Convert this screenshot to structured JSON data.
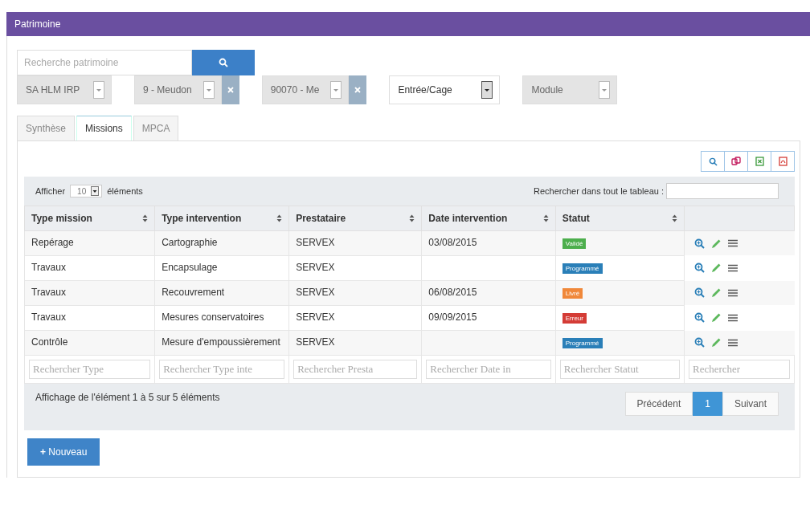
{
  "window": {
    "title": "Patrimoine"
  },
  "search": {
    "placeholder": "Recherche patrimoine"
  },
  "filters": [
    {
      "value": "SA HLM IRP",
      "disabled": true,
      "clearable": false
    },
    {
      "value": "9 - Meudon",
      "disabled": true,
      "clearable": true
    },
    {
      "value": "90070 - Me",
      "disabled": true,
      "clearable": true
    },
    {
      "value": "Entrée/Cage",
      "disabled": false,
      "clearable": false
    },
    {
      "value": "Module",
      "disabled": true,
      "clearable": false
    }
  ],
  "tabs": [
    {
      "label": "Synthèse",
      "selected": false
    },
    {
      "label": "Missions",
      "selected": true
    },
    {
      "label": "MPCA",
      "selected": false
    }
  ],
  "toolbar": [
    {
      "kind": "search"
    },
    {
      "kind": "copy"
    },
    {
      "kind": "excel"
    },
    {
      "kind": "pdf"
    }
  ],
  "length": {
    "before": "Afficher",
    "value": "10",
    "after": "éléments"
  },
  "global_search": {
    "label": "Rechercher dans tout le tableau :"
  },
  "table": {
    "columns": [
      "Type mission",
      "Type intervention",
      "Prestataire",
      "Date intervention",
      "Statut"
    ],
    "rows": [
      {
        "cells": [
          "Repérage",
          "Cartographie",
          "SERVEX",
          "03/08/2015"
        ],
        "status": {
          "label": "Validé",
          "color": "#4cae4c"
        }
      },
      {
        "cells": [
          "Travaux",
          "Encapsulage",
          "SERVEX",
          ""
        ],
        "status": {
          "label": "Programmé",
          "color": "#2a7fb8"
        }
      },
      {
        "cells": [
          "Travaux",
          "Recouvrement",
          "SERVEX",
          "06/08/2015"
        ],
        "status": {
          "label": "Livré",
          "color": "#f0883a"
        }
      },
      {
        "cells": [
          "Travaux",
          "Mesures conservatoires",
          "SERVEX",
          "09/09/2015"
        ],
        "status": {
          "label": "Erreur",
          "color": "#d43c36"
        }
      },
      {
        "cells": [
          "Contrôle",
          "Mesure d'empoussièrement",
          "SERVEX",
          ""
        ],
        "status": {
          "label": "Programmé",
          "color": "#2a7fb8"
        }
      }
    ],
    "column_filters": [
      {
        "placeholder": "Rechercher Type"
      },
      {
        "placeholder": "Rechercher Type inte"
      },
      {
        "placeholder": "Rechercher Presta"
      },
      {
        "placeholder": "Rechercher Date in"
      },
      {
        "placeholder": "Rechercher Statut"
      },
      {
        "placeholder": "Rechercher"
      }
    ]
  },
  "info": "Affichage de l'élément 1 à 5 sur 5 éléments",
  "pagination": [
    {
      "label": "Précédent",
      "selected": false
    },
    {
      "label": "1",
      "selected": true
    },
    {
      "label": "Suivant",
      "selected": false
    }
  ],
  "new_button": {
    "icon": "+",
    "label": "Nouveau"
  }
}
